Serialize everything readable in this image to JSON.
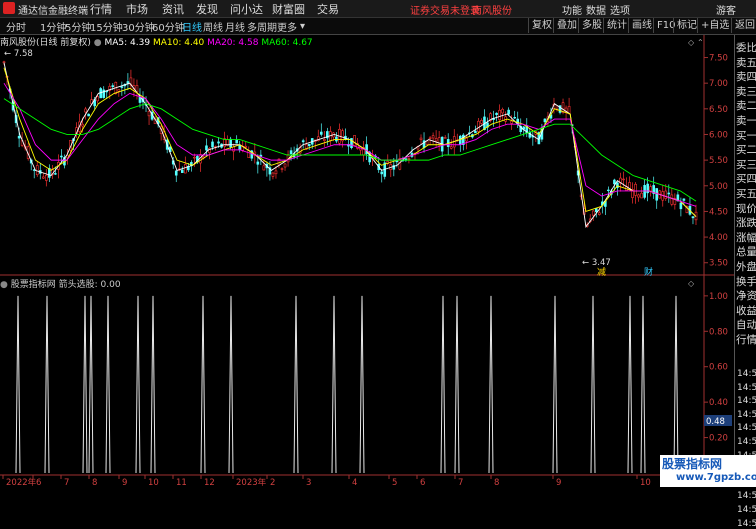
{
  "title_bar": {
    "app_name": "通达信金融终端",
    "menus": [
      "行情",
      "市场",
      "资讯",
      "发现",
      "问小达",
      "财富圈",
      "交易"
    ],
    "warning": "证券交易未登录",
    "stock_link": "南风股份",
    "right_menus": [
      "功能",
      "数据",
      "选项"
    ],
    "guest": "游客"
  },
  "toolbar": {
    "periods": [
      "分时",
      "1分钟",
      "5分钟",
      "15分钟",
      "30分钟",
      "60分钟",
      "日线",
      "周线",
      "月线",
      "多周期",
      "更多"
    ],
    "active_period": "日线",
    "right_buttons": [
      "复权",
      "叠加",
      "多股",
      "统计",
      "画线",
      "F10",
      "标记",
      "+自选",
      "返回"
    ]
  },
  "main_chart": {
    "stock_label": "南风股份(日线 前复权)",
    "ma5": "MA5: 4.39",
    "ma10": "MA10: 4.40",
    "ma20": "MA20: 4.58",
    "ma60": "MA60: 4.67",
    "high_label": "7.58",
    "low_label": "3.47",
    "y_ticks": [
      "7.50",
      "7.00",
      "6.50",
      "6.00",
      "5.50",
      "5.00",
      "4.50",
      "4.00",
      "3.50"
    ],
    "markers": [
      "减",
      "财"
    ],
    "colors": {
      "up": "#ff3232",
      "down": "#54ffff",
      "ma5": "#ffffff",
      "ma10": "#ffff00",
      "ma20": "#ff00ff",
      "ma60": "#00ff00"
    }
  },
  "sub_chart": {
    "indicator_source": "股票指标网",
    "indicator_name": "箭头选股: 0.00",
    "y_ticks": [
      "1.00",
      "0.80",
      "0.60",
      "0.40",
      "0.20"
    ],
    "current_value": "0.48"
  },
  "x_axis": {
    "labels": [
      "2022年",
      "6",
      "7",
      "8",
      "9",
      "10",
      "11",
      "12",
      "2023年",
      "2",
      "3",
      "4",
      "5",
      "6",
      "7",
      "8",
      "9",
      "10"
    ]
  },
  "right_panel": {
    "items": [
      "委比",
      "卖五",
      "卖四",
      "卖三",
      "卖二",
      "卖一",
      "买一",
      "买二",
      "买三",
      "买四",
      "买五",
      "现价",
      "涨跌",
      "涨幅",
      "总量",
      "外盘",
      "换手",
      "净资",
      "收益",
      "自动",
      "行情"
    ],
    "times": [
      "14:5",
      "14:5",
      "14:5",
      "14:5",
      "14:5",
      "14:5",
      "14:5",
      "14:5",
      "14:5",
      "14:5",
      "14:5",
      "14:5"
    ]
  },
  "watermark": {
    "line1": "股票指标网",
    "line2": "www.7gpzb.com"
  },
  "chart_data": [
    {
      "type": "candlestick",
      "title": "南风股份(日线 前复权)",
      "ylim": [
        3.3,
        7.9
      ],
      "y_ticks": [
        7.5,
        7.0,
        6.5,
        6.0,
        5.5,
        5.0,
        4.5,
        4.0,
        3.5
      ],
      "x_ticks": [
        "2022年",
        "6",
        "7",
        "8",
        "9",
        "10",
        "11",
        "12",
        "2023年",
        "2",
        "3",
        "4",
        "5",
        "6",
        "7",
        "8",
        "9",
        "10"
      ],
      "series": [
        {
          "name": "MA5",
          "values": [
            7.4,
            6.0,
            5.3,
            5.2,
            5.6,
            6.3,
            6.8,
            6.9,
            7.0,
            6.6,
            6.1,
            5.3,
            5.4,
            5.7,
            5.8,
            5.8,
            5.6,
            5.3,
            5.5,
            5.8,
            5.9,
            6.0,
            5.9,
            5.7,
            5.3,
            5.4,
            5.7,
            5.9,
            5.8,
            5.9,
            6.1,
            6.3,
            6.4,
            6.1,
            5.9,
            6.6,
            6.4,
            4.2,
            4.6,
            5.1,
            4.9,
            4.9,
            4.8,
            4.7,
            4.4
          ]
        },
        {
          "name": "MA10",
          "values": [
            7.3,
            6.3,
            5.5,
            5.3,
            5.5,
            6.1,
            6.6,
            6.8,
            6.9,
            6.7,
            6.2,
            5.5,
            5.4,
            5.6,
            5.7,
            5.8,
            5.6,
            5.4,
            5.5,
            5.7,
            5.8,
            5.9,
            5.9,
            5.7,
            5.4,
            5.5,
            5.6,
            5.8,
            5.8,
            5.9,
            6.0,
            6.2,
            6.3,
            6.2,
            6.0,
            6.5,
            6.4,
            4.5,
            4.6,
            5.0,
            4.9,
            4.9,
            4.8,
            4.7,
            4.4
          ]
        },
        {
          "name": "MA20",
          "values": [
            7.0,
            6.5,
            5.8,
            5.5,
            5.5,
            5.9,
            6.3,
            6.6,
            6.8,
            6.7,
            6.3,
            5.8,
            5.6,
            5.6,
            5.7,
            5.7,
            5.6,
            5.5,
            5.5,
            5.6,
            5.7,
            5.8,
            5.8,
            5.7,
            5.5,
            5.5,
            5.6,
            5.7,
            5.8,
            5.8,
            5.9,
            6.1,
            6.2,
            6.2,
            6.1,
            6.3,
            6.3,
            5.0,
            4.8,
            4.9,
            4.9,
            4.9,
            4.8,
            4.7,
            4.6
          ]
        },
        {
          "name": "MA60",
          "values": [
            6.7,
            6.5,
            6.3,
            6.1,
            6.0,
            6.0,
            6.1,
            6.3,
            6.5,
            6.6,
            6.5,
            6.3,
            6.1,
            6.0,
            5.9,
            5.9,
            5.8,
            5.7,
            5.6,
            5.6,
            5.6,
            5.6,
            5.6,
            5.6,
            5.5,
            5.5,
            5.5,
            5.5,
            5.6,
            5.6,
            5.7,
            5.8,
            5.9,
            6.0,
            6.1,
            6.2,
            6.2,
            5.9,
            5.6,
            5.4,
            5.2,
            5.1,
            5.0,
            4.9,
            4.7
          ]
        }
      ]
    },
    {
      "type": "bar",
      "title": "箭头选股: 0.00",
      "ylim": [
        0,
        1.05
      ],
      "y_ticks": [
        1.0,
        0.8,
        0.6,
        0.4,
        0.2
      ],
      "spike_positions": [
        18,
        47,
        85,
        91,
        108,
        138,
        153,
        203,
        231,
        296,
        334,
        362,
        443,
        457,
        491,
        555,
        593,
        630,
        643,
        676
      ],
      "spike_heights": [
        1.0,
        1.0,
        1.0,
        1.0,
        1.0,
        1.0,
        1.0,
        1.0,
        1.0,
        1.0,
        1.0,
        1.0,
        1.0,
        1.0,
        1.0,
        1.0,
        1.0,
        1.0,
        1.0,
        1.0
      ]
    }
  ]
}
